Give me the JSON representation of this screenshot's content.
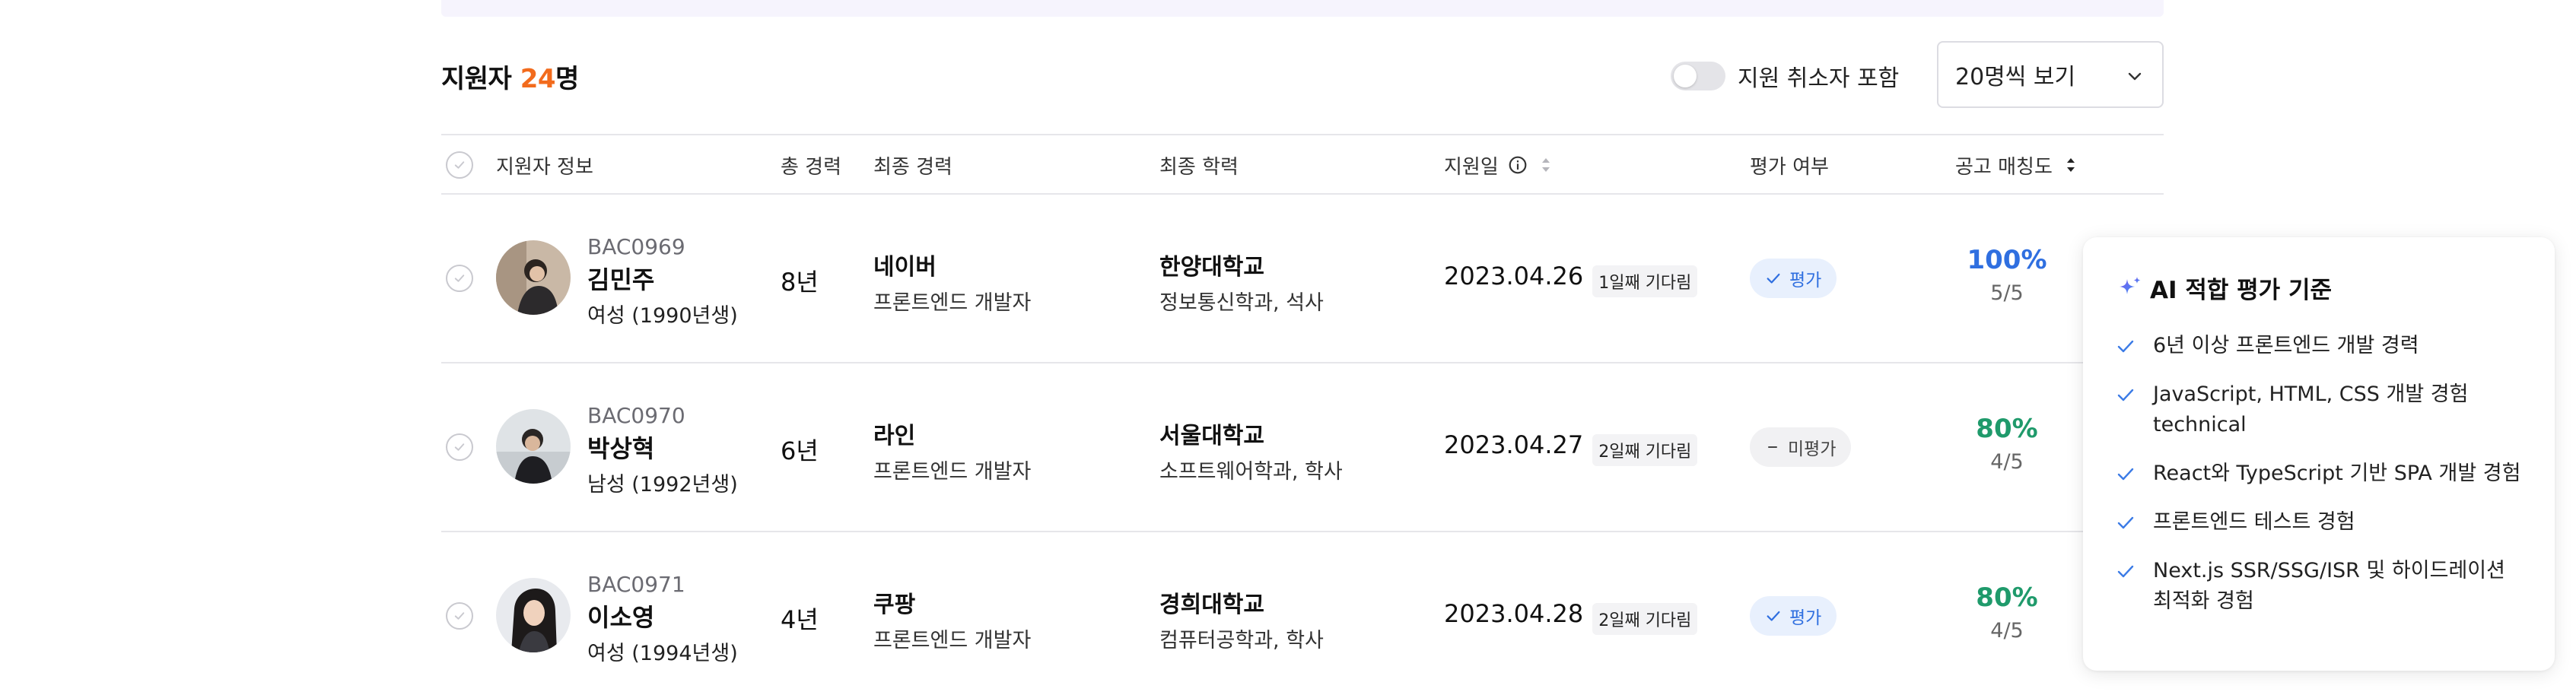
{
  "header": {
    "title_prefix": "지원자 ",
    "count": "24",
    "title_suffix": "명",
    "toggle_label": "지원 취소자 포함",
    "page_size": "20명씩 보기"
  },
  "columns": {
    "applicant_info": "지원자 정보",
    "total_career": "총 경력",
    "last_career": "최종 경력",
    "education": "최종 학력",
    "apply_date": "지원일",
    "evaluation": "평가 여부",
    "match": "공고 매칭도"
  },
  "rows": [
    {
      "id": "BAC0969",
      "name": "김민주",
      "meta": "여성 (1990년생)",
      "years": "8년",
      "company": "네이버",
      "job": "프론트엔드 개발자",
      "school": "한양대학교",
      "major": "정보통신학과, 석사",
      "date": "2023.04.26",
      "wait": "1일째 기다림",
      "eval": "평가",
      "match": "100%",
      "score": "5/5"
    },
    {
      "id": "BAC0970",
      "name": "박상혁",
      "meta": "남성 (1992년생)",
      "years": "6년",
      "company": "라인",
      "job": "프론트엔드 개발자",
      "school": "서울대학교",
      "major": "소프트웨어학과, 학사",
      "date": "2023.04.27",
      "wait": "2일째 기다림",
      "eval": "미평가",
      "match": "80%",
      "score": "4/5"
    },
    {
      "id": "BAC0971",
      "name": "이소영",
      "meta": "여성 (1994년생)",
      "years": "4년",
      "company": "쿠팡",
      "job": "프론트엔드 개발자",
      "school": "경희대학교",
      "major": "컴퓨터공학과, 학사",
      "date": "2023.04.28",
      "wait": "2일째 기다림",
      "eval": "평가",
      "match": "80%",
      "score": "4/5"
    }
  ],
  "ai_panel": {
    "title": "AI 적합 평가 기준",
    "criteria": [
      "6년 이상 프론트엔드 개발 경력",
      "JavaScript, HTML, CSS 개발 경험 technical",
      "React와 TypeScript 기반 SPA 개발 경험",
      "프론트엔드 테스트 경험",
      "Next.js SSR/SSG/ISR 및 하이드레이션 최적화 경험"
    ]
  },
  "colors": {
    "accent_orange": "#f26b1d",
    "match_blue": "#2f6fe0",
    "match_green": "#1f9a6b",
    "eval_done_bg": "#e8f0fd"
  },
  "icons": {
    "select": "check-circle-icon",
    "info": "info-icon",
    "sort": "sort-icon",
    "chevron": "chevron-down-icon",
    "sparkle": "sparkle-icon",
    "check": "check-icon",
    "minus": "minus-icon"
  }
}
